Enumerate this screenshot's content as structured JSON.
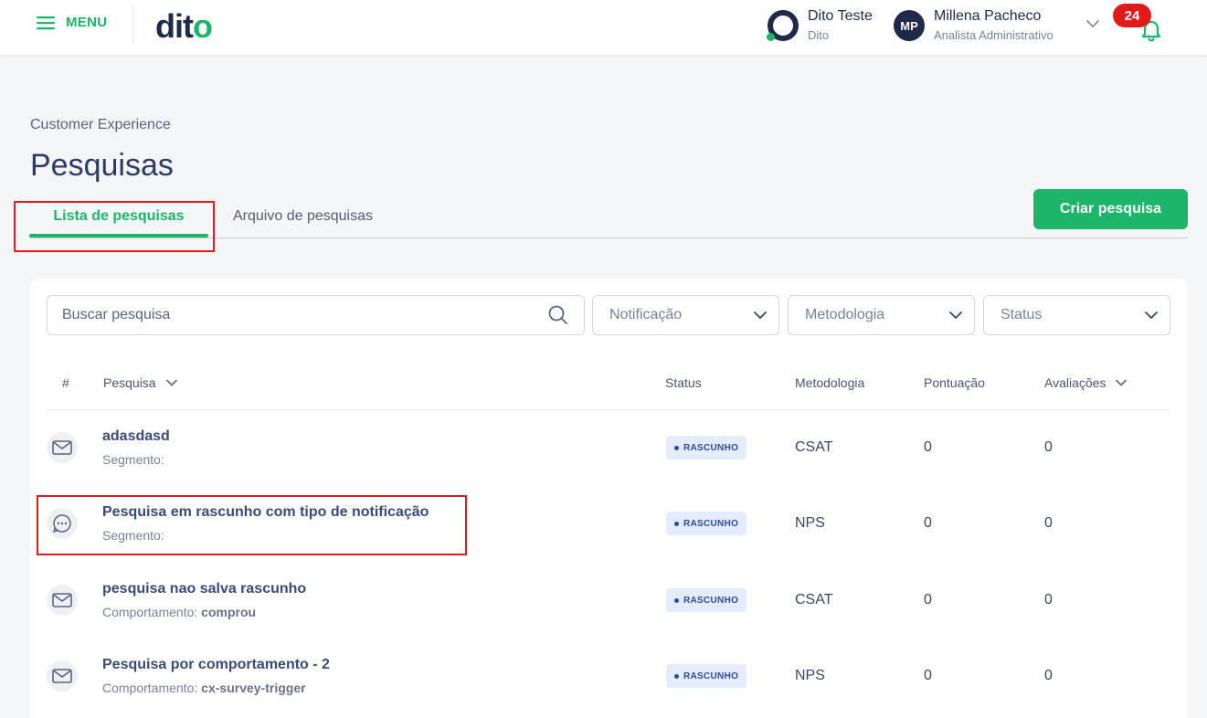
{
  "topbar": {
    "menu_label": "MENU",
    "logo_text": "dit",
    "logo_suffix": "o",
    "account": {
      "name": "Dito Teste",
      "sub": "Dito"
    },
    "user": {
      "initials": "MP",
      "name": "Millena Pacheco",
      "role": "Analista Administrativo"
    },
    "notifications_count": "24"
  },
  "page": {
    "breadcrumb": "Customer Experience",
    "title": "Pesquisas",
    "tabs": [
      {
        "label": "Lista de pesquisas",
        "active": true
      },
      {
        "label": "Arquivo de pesquisas",
        "active": false
      }
    ],
    "create_button": "Criar pesquisa"
  },
  "filters": {
    "search_placeholder": "Buscar pesquisa",
    "notification": "Notificação",
    "methodology": "Metodologia",
    "status": "Status"
  },
  "table": {
    "headers": {
      "index": "#",
      "survey": "Pesquisa",
      "status": "Status",
      "methodology": "Metodologia",
      "score": "Pontuação",
      "ratings": "Avaliações"
    },
    "rows": [
      {
        "icon": "envelope-icon",
        "title": "adasdasd",
        "seg_label": "Segmento:",
        "seg_value": "",
        "status": "RASCUNHO",
        "methodology": "CSAT",
        "score": "0",
        "ratings": "0"
      },
      {
        "icon": "chat-bubble-icon",
        "title": "Pesquisa em rascunho com tipo de notificação",
        "seg_label": "Segmento:",
        "seg_value": "",
        "status": "RASCUNHO",
        "methodology": "NPS",
        "score": "0",
        "ratings": "0"
      },
      {
        "icon": "envelope-icon",
        "title": "pesquisa nao salva rascunho",
        "seg_label": "Comportamento:",
        "seg_value": "comprou",
        "status": "RASCUNHO",
        "methodology": "CSAT",
        "score": "0",
        "ratings": "0"
      },
      {
        "icon": "envelope-icon",
        "title": "Pesquisa por comportamento - 2",
        "seg_label": "Comportamento:",
        "seg_value": "cx-survey-trigger",
        "status": "RASCUNHO",
        "methodology": "NPS",
        "score": "0",
        "ratings": "0"
      }
    ]
  },
  "colors": {
    "brand_green": "#1db56a",
    "navy": "#1f2a4a",
    "alert_red": "#e21a1a",
    "status_bg": "#e3ecfb"
  }
}
